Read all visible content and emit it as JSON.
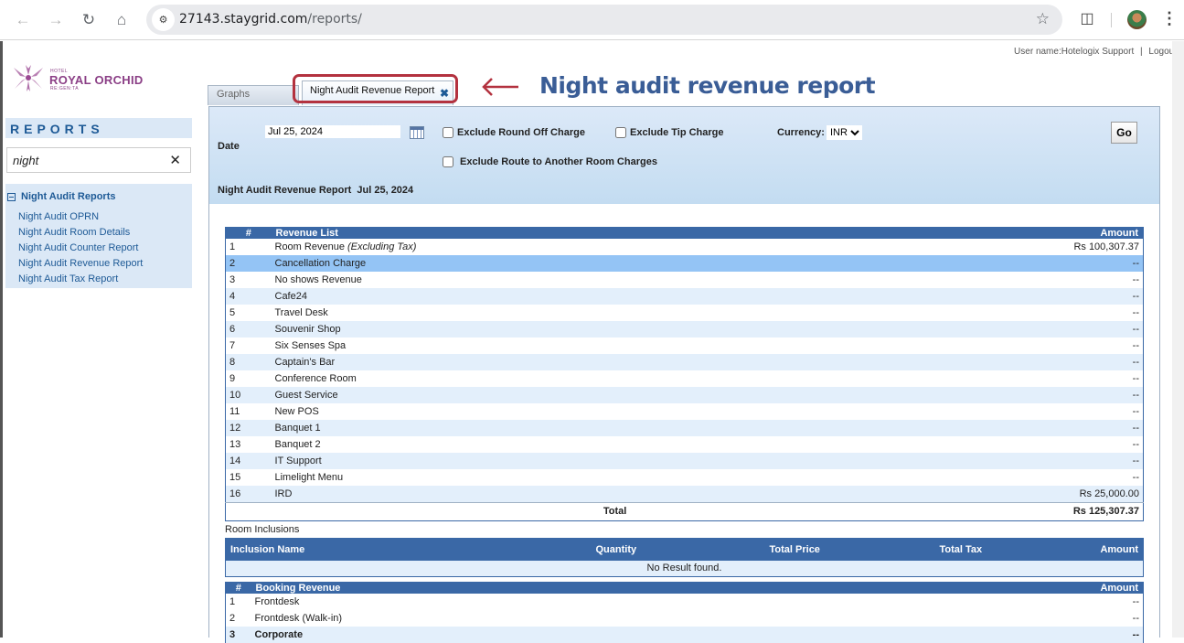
{
  "browser": {
    "url_host": "27143.staygrid.com",
    "url_path": "/reports/"
  },
  "userbar": {
    "user_label": "User name:Hotelogix Support",
    "separator": "|",
    "logout": "Logout"
  },
  "logo": {
    "hotel": "HOTEL",
    "name": "ROYAL ORCHID",
    "sub": "RE:GEN:TA",
    "color": "#8b3f86"
  },
  "sidebar": {
    "title": "REPORTS",
    "search_value": "night",
    "group": "Night Audit Reports",
    "items": [
      {
        "label": "Night Audit OPRN"
      },
      {
        "label": "Night Audit Room Details"
      },
      {
        "label": "Night Audit Counter Report"
      },
      {
        "label": "Night Audit Revenue Report"
      },
      {
        "label": "Night Audit Tax Report"
      }
    ]
  },
  "tabs": [
    {
      "label": "Graphs",
      "active": false
    },
    {
      "label": "Night Audit Revenue Report",
      "active": true
    }
  ],
  "annotation": {
    "text": "Night audit revenue report",
    "color": "#b3323f"
  },
  "filters": {
    "date_label": "Date",
    "date_value": "Jul 25, 2024",
    "exclude_round_off": "Exclude Round Off Charge",
    "exclude_tip": "Exclude Tip Charge",
    "exclude_route": "Exclude Route to Another Room Charges",
    "currency_label": "Currency:",
    "currency_value": "INR",
    "go": "Go"
  },
  "report": {
    "title": "Night Audit Revenue Report",
    "date": "Jul 25, 2024"
  },
  "revenue": {
    "headers": {
      "num": "#",
      "name": "Revenue List",
      "amount": "Amount"
    },
    "rows": [
      {
        "num": "1",
        "name": "Room Revenue",
        "note": "(Excluding Tax)",
        "amount": "Rs 100,307.37"
      },
      {
        "num": "2",
        "name": "Cancellation Charge",
        "amount": "--"
      },
      {
        "num": "3",
        "name": "No shows Revenue",
        "amount": "--"
      },
      {
        "num": "4",
        "name": "Cafe24",
        "amount": "--"
      },
      {
        "num": "5",
        "name": "Travel Desk",
        "amount": "--"
      },
      {
        "num": "6",
        "name": "Souvenir Shop",
        "amount": "--"
      },
      {
        "num": "7",
        "name": "Six Senses Spa",
        "amount": "--"
      },
      {
        "num": "8",
        "name": "Captain's Bar",
        "amount": "--"
      },
      {
        "num": "9",
        "name": "Conference Room",
        "amount": "--"
      },
      {
        "num": "10",
        "name": "Guest Service",
        "amount": "--"
      },
      {
        "num": "11",
        "name": "New POS",
        "amount": "--"
      },
      {
        "num": "12",
        "name": "Banquet 1",
        "amount": "--"
      },
      {
        "num": "13",
        "name": "Banquet 2",
        "amount": "--"
      },
      {
        "num": "14",
        "name": "IT Support",
        "amount": "--"
      },
      {
        "num": "15",
        "name": "Limelight Menu",
        "amount": "--"
      },
      {
        "num": "16",
        "name": "IRD",
        "amount": "Rs 25,000.00"
      }
    ],
    "total_label": "Total",
    "total_amount": "Rs 125,307.37"
  },
  "inclusions": {
    "label": "Room Inclusions",
    "headers": {
      "name": "Inclusion Name",
      "quantity": "Quantity",
      "total_price": "Total Price",
      "total_tax": "Total Tax",
      "amount": "Amount"
    },
    "empty": "No Result found."
  },
  "booking": {
    "headers": {
      "num": "#",
      "name": "Booking Revenue",
      "amount": "Amount"
    },
    "rows": [
      {
        "num": "1",
        "name": "Frontdesk",
        "amount": "--"
      },
      {
        "num": "2",
        "name": "Frontdesk (Walk-in)",
        "amount": "--"
      },
      {
        "num": "3",
        "name": "Corporate",
        "amount": "--"
      }
    ]
  }
}
